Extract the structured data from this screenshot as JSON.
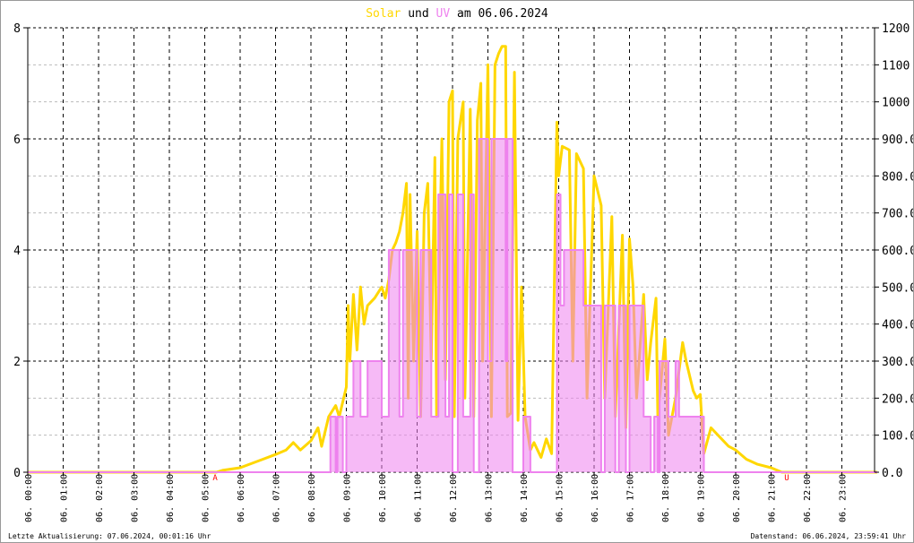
{
  "chart_data": {
    "type": "line",
    "title": {
      "part1": "Solar",
      "part2": " und ",
      "part3": "UV",
      "part4": " am 06.06.2024"
    },
    "x_ticks": [
      "06. 00:00",
      "06. 01:00",
      "06. 02:00",
      "06. 03:00",
      "06. 04:00",
      "06. 05:00",
      "06. 06:00",
      "06. 07:00",
      "06. 08:00",
      "06. 09:00",
      "06. 10:00",
      "06. 11:00",
      "06. 12:00",
      "06. 13:00",
      "06. 14:00",
      "06. 15:00",
      "06. 16:00",
      "06. 17:00",
      "06. 18:00",
      "06. 19:00",
      "06. 20:00",
      "06. 21:00",
      "06. 22:00",
      "06. 23:00"
    ],
    "xlim": [
      0,
      24
    ],
    "y_left": {
      "lim": [
        0,
        8
      ],
      "ticks": [
        "0",
        "2",
        "4",
        "6",
        "8"
      ]
    },
    "y_right": {
      "lim": [
        0,
        1200
      ],
      "ticks": [
        "0.0",
        "100.0",
        "200.0",
        "300.0",
        "400.0",
        "500.0",
        "600.0",
        "700.0",
        "800.0",
        "900.0",
        "1000",
        "1100",
        "1200"
      ]
    },
    "markers": [
      {
        "label": "A",
        "hour": 5.3
      },
      {
        "label": "U",
        "hour": 21.45
      }
    ],
    "colors": {
      "solar": "#ffd700",
      "uv": "#ee82ee",
      "marker": "#ff0000"
    },
    "series": [
      {
        "name": "Solar",
        "axis": "right",
        "points": [
          [
            0,
            0
          ],
          [
            5.33,
            0
          ],
          [
            5.5,
            5
          ],
          [
            6,
            12
          ],
          [
            6.5,
            30
          ],
          [
            7,
            48
          ],
          [
            7.3,
            60
          ],
          [
            7.5,
            80
          ],
          [
            7.7,
            60
          ],
          [
            8,
            85
          ],
          [
            8.2,
            120
          ],
          [
            8.3,
            70
          ],
          [
            8.5,
            150
          ],
          [
            8.7,
            180
          ],
          [
            8.8,
            150
          ],
          [
            9,
            230
          ],
          [
            9.05,
            450
          ],
          [
            9.1,
            300
          ],
          [
            9.2,
            480
          ],
          [
            9.3,
            330
          ],
          [
            9.4,
            500
          ],
          [
            9.5,
            400
          ],
          [
            9.6,
            450
          ],
          [
            9.8,
            470
          ],
          [
            10,
            500
          ],
          [
            10.1,
            470
          ],
          [
            10.2,
            520
          ],
          [
            10.3,
            600
          ],
          [
            10.4,
            620
          ],
          [
            10.5,
            650
          ],
          [
            10.6,
            700
          ],
          [
            10.7,
            780
          ],
          [
            10.75,
            200
          ],
          [
            10.8,
            750
          ],
          [
            10.9,
            300
          ],
          [
            11,
            650
          ],
          [
            11.1,
            150
          ],
          [
            11.2,
            700
          ],
          [
            11.3,
            780
          ],
          [
            11.4,
            300
          ],
          [
            11.5,
            850
          ],
          [
            11.55,
            150
          ],
          [
            11.7,
            900
          ],
          [
            11.8,
            250
          ],
          [
            11.9,
            1000
          ],
          [
            12,
            1030
          ],
          [
            12.05,
            150
          ],
          [
            12.15,
            900
          ],
          [
            12.3,
            1000
          ],
          [
            12.35,
            200
          ],
          [
            12.5,
            980
          ],
          [
            12.6,
            150
          ],
          [
            12.7,
            950
          ],
          [
            12.8,
            1050
          ],
          [
            12.85,
            300
          ],
          [
            13,
            1100
          ],
          [
            13.1,
            150
          ],
          [
            13.2,
            1100
          ],
          [
            13.3,
            1130
          ],
          [
            13.4,
            1150
          ],
          [
            13.5,
            1150
          ],
          [
            13.55,
            150
          ],
          [
            13.65,
            160
          ],
          [
            13.75,
            1080
          ],
          [
            13.85,
            140
          ],
          [
            13.95,
            500
          ],
          [
            14.05,
            150
          ],
          [
            14.2,
            60
          ],
          [
            14.3,
            80
          ],
          [
            14.5,
            40
          ],
          [
            14.65,
            90
          ],
          [
            14.8,
            50
          ],
          [
            14.95,
            945
          ],
          [
            15,
            800
          ],
          [
            15.1,
            880
          ],
          [
            15.3,
            870
          ],
          [
            15.4,
            300
          ],
          [
            15.5,
            860
          ],
          [
            15.7,
            820
          ],
          [
            15.8,
            200
          ],
          [
            16,
            800
          ],
          [
            16.2,
            720
          ],
          [
            16.3,
            200
          ],
          [
            16.5,
            690
          ],
          [
            16.6,
            150
          ],
          [
            16.8,
            640
          ],
          [
            16.9,
            120
          ],
          [
            17,
            630
          ],
          [
            17.1,
            500
          ],
          [
            17.2,
            200
          ],
          [
            17.4,
            480
          ],
          [
            17.5,
            250
          ],
          [
            17.6,
            350
          ],
          [
            17.75,
            470
          ],
          [
            17.8,
            150
          ],
          [
            18,
            360
          ],
          [
            18.1,
            100
          ],
          [
            18.3,
            200
          ],
          [
            18.5,
            350
          ],
          [
            18.6,
            300
          ],
          [
            18.8,
            220
          ],
          [
            18.9,
            200
          ],
          [
            19,
            210
          ],
          [
            19.1,
            50
          ],
          [
            19.3,
            120
          ],
          [
            19.6,
            90
          ],
          [
            19.8,
            70
          ],
          [
            20,
            60
          ],
          [
            20.3,
            35
          ],
          [
            20.6,
            22
          ],
          [
            21,
            12
          ],
          [
            21.3,
            0
          ],
          [
            24,
            0
          ]
        ]
      },
      {
        "name": "UV",
        "axis": "left",
        "step": true,
        "points": [
          [
            0,
            0
          ],
          [
            8.55,
            1
          ],
          [
            8.7,
            0
          ],
          [
            8.75,
            1
          ],
          [
            8.9,
            0
          ],
          [
            9,
            1
          ],
          [
            9.2,
            2
          ],
          [
            9.4,
            1
          ],
          [
            9.6,
            2
          ],
          [
            9.85,
            2
          ],
          [
            10,
            1
          ],
          [
            10.2,
            4
          ],
          [
            10.5,
            1
          ],
          [
            10.6,
            4
          ],
          [
            11,
            1
          ],
          [
            11.1,
            4
          ],
          [
            11.4,
            1
          ],
          [
            11.6,
            5
          ],
          [
            11.8,
            1
          ],
          [
            11.9,
            5
          ],
          [
            12,
            0
          ],
          [
            12.15,
            5
          ],
          [
            12.3,
            1
          ],
          [
            12.5,
            5
          ],
          [
            12.6,
            0
          ],
          [
            12.75,
            6
          ],
          [
            13,
            2
          ],
          [
            13.1,
            6
          ],
          [
            13.5,
            2
          ],
          [
            13.55,
            6
          ],
          [
            13.7,
            0
          ],
          [
            14,
            1
          ],
          [
            14.2,
            0
          ],
          [
            14.95,
            5
          ],
          [
            15.05,
            3
          ],
          [
            15.15,
            4
          ],
          [
            15.6,
            4
          ],
          [
            15.7,
            3
          ],
          [
            16.2,
            0
          ],
          [
            16.3,
            3
          ],
          [
            16.6,
            0
          ],
          [
            16.7,
            3
          ],
          [
            16.9,
            0
          ],
          [
            17,
            3
          ],
          [
            17.4,
            1
          ],
          [
            17.6,
            0
          ],
          [
            17.7,
            1
          ],
          [
            17.8,
            0
          ],
          [
            17.85,
            2
          ],
          [
            18.1,
            1
          ],
          [
            18.3,
            2
          ],
          [
            18.4,
            1
          ],
          [
            19,
            1
          ],
          [
            19.1,
            0
          ],
          [
            24,
            0
          ]
        ]
      }
    ]
  },
  "footer": {
    "left": "Letzte Aktualisierung: 07.06.2024, 00:01:16 Uhr",
    "right": "Datenstand: 06.06.2024, 23:59:41 Uhr"
  }
}
